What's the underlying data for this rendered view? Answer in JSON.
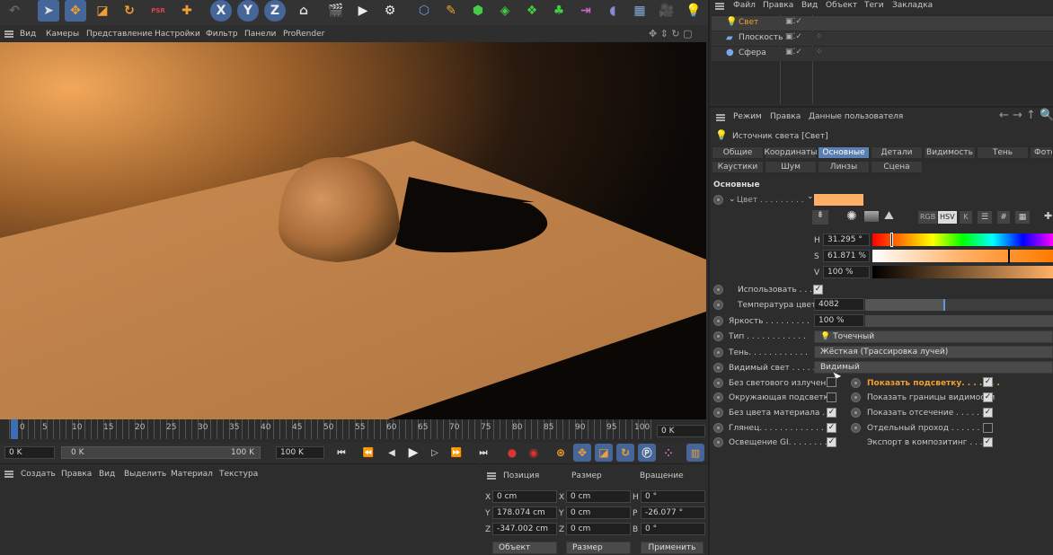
{
  "toolbar": {
    "x": "X",
    "y": "Y",
    "z": "Z"
  },
  "viewport_menu": [
    "Вид",
    "Камеры",
    "Представление",
    "Настройки",
    "Фильтр",
    "Панели",
    "ProRender"
  ],
  "om_menu": [
    "Файл",
    "Правка",
    "Вид",
    "Объект",
    "Теги",
    "Закладка"
  ],
  "objects": [
    {
      "name": "Свет",
      "color": "#f0a030"
    },
    {
      "name": "Плоскость",
      "color": "#7aa8e6"
    },
    {
      "name": "Сфера",
      "color": "#7aa8e6"
    }
  ],
  "attr_menu": [
    "Режим",
    "Правка",
    "Данные пользователя"
  ],
  "attr_title": "Источник света [Свет]",
  "tabs_row1": [
    "Общие",
    "Координаты",
    "Основные",
    "Детали",
    "Видимость",
    "Тень",
    "Фото"
  ],
  "tabs_row2": [
    "Каустики",
    "Шум",
    "Линзы",
    "Сцена"
  ],
  "section": "Основные",
  "color_label": "Цвет . . . . . . . . .",
  "color_swatch": "#ffb066",
  "color_modes": [
    "RGB",
    "HSV",
    "K"
  ],
  "hsv": {
    "h_label": "H",
    "h_value": "31.295 °",
    "s_label": "S",
    "s_value": "61.871 %",
    "v_label": "V",
    "v_value": "100 %"
  },
  "props": {
    "use_label": "Использовать . . .",
    "temp_label": "Температура цвета",
    "temp_value": "4082",
    "bright_label": "Яркость . . . . . . . . .",
    "bright_value": "100 %",
    "type_label": "Тип . . . . . . . . . . . .",
    "type_value": "Точечный",
    "shadow_label": "Тень. . . . . . . . . . . .",
    "shadow_value": "Жёсткая (Трассировка лучей)",
    "visible_label": "Видимый свет . . . . . .",
    "visible_value": "Видимый"
  },
  "checks_left": [
    {
      "label": "Без светового излучения",
      "on": false
    },
    {
      "label": "Окружающая подсветка",
      "on": false
    },
    {
      "label": "Без цвета материала . . .",
      "on": true
    },
    {
      "label": "Глянец. . . . . . . . . . . . .",
      "on": true
    },
    {
      "label": "Освещение GI. . . . . . . . .",
      "on": true
    }
  ],
  "checks_right": [
    {
      "label": "Показать подсветку. . . . . . .",
      "on": true,
      "highlight": true
    },
    {
      "label": "Показать границы видимости",
      "on": true
    },
    {
      "label": "Показать отсечение . . . . . .",
      "on": true
    },
    {
      "label": "Отдельный проход . . . . . .",
      "on": false
    },
    {
      "label": "Экспорт в композитинг . . . .",
      "on": true
    }
  ],
  "timeline": {
    "ticks": [
      "0",
      "5",
      "10",
      "15",
      "20",
      "25",
      "30",
      "35",
      "40",
      "45",
      "50",
      "55",
      "60",
      "65",
      "70",
      "75",
      "80",
      "85",
      "90",
      "95",
      "100"
    ],
    "current_frame": "0 K",
    "start": "0 K",
    "range_start": "0 K",
    "range_end": "100 K",
    "end": "100 K"
  },
  "material_menu": [
    "Создать",
    "Правка",
    "Вид",
    "Выделить",
    "Материал",
    "Текстура"
  ],
  "coords": {
    "headers": [
      "Позиция",
      "Размер",
      "Вращение"
    ],
    "pos": [
      {
        "axis": "X",
        "value": "0 cm"
      },
      {
        "axis": "Y",
        "value": "178.074 cm"
      },
      {
        "axis": "Z",
        "value": "-347.002 cm"
      }
    ],
    "size": [
      {
        "axis": "X",
        "value": "0 cm"
      },
      {
        "axis": "Y",
        "value": "0 cm"
      },
      {
        "axis": "Z",
        "value": "0 cm"
      }
    ],
    "rot": [
      {
        "axis": "H",
        "value": "0 °"
      },
      {
        "axis": "P",
        "value": "-26.077 °"
      },
      {
        "axis": "B",
        "value": "0 °"
      }
    ],
    "mode": "Объект",
    "size_mode": "Размер",
    "apply": "Применить"
  }
}
